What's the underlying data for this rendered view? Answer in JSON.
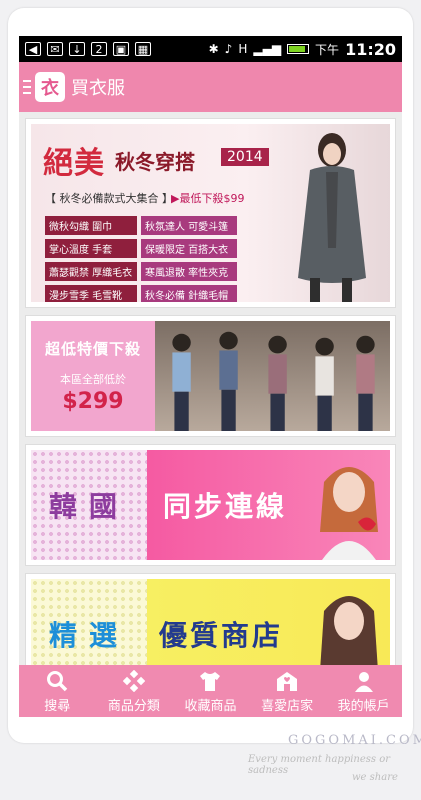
{
  "status_bar": {
    "time": "11:20",
    "ampm": "下午",
    "icons": [
      "back-icon",
      "mail-icon",
      "download-icon",
      "calendar-icon",
      "image-icon",
      "app-icon",
      "bluetooth-icon",
      "mute-icon",
      "hplus-icon",
      "signal-icon",
      "battery-icon"
    ]
  },
  "app_bar": {
    "logo_char": "衣",
    "title": "買衣服"
  },
  "banners": {
    "winter": {
      "headline_a": "絕美",
      "headline_b": "秋冬穿搭",
      "year": "2014",
      "subtitle": "【 秋冬必備款式大集合 】",
      "promo": "▶最低下殺$99",
      "items": [
        "微秋勾織 圍巾",
        "秋氛達人 可愛斗篷",
        "掌心溫度 手套",
        "保暖限定 百搭大衣",
        "蕭瑟觀禁 厚織毛衣",
        "寒風退散 率性夾克",
        "漫步雪季 毛雪靴",
        "秋冬必備 針織毛帽"
      ]
    },
    "sale": {
      "line1": "超低特價下殺",
      "line2": "本區全部低於",
      "price": "$299"
    },
    "korea": {
      "left": "韓國",
      "right": "同步連線"
    },
    "select": {
      "left": "精選",
      "right": "優質商店"
    }
  },
  "tabs": [
    {
      "label": "搜尋",
      "icon": "search-icon"
    },
    {
      "label": "商品分類",
      "icon": "category-icon"
    },
    {
      "label": "收藏商品",
      "icon": "shirt-icon"
    },
    {
      "label": "喜愛店家",
      "icon": "store-icon"
    },
    {
      "label": "我的帳戶",
      "icon": "account-icon"
    }
  ],
  "watermark": {
    "site": "GOGOMAI.COM",
    "line1": "Every moment happiness or sadness",
    "line2": "we share"
  },
  "colors": {
    "brand_pink": "#ef87ad",
    "tab_pink": "#f08ab0"
  }
}
